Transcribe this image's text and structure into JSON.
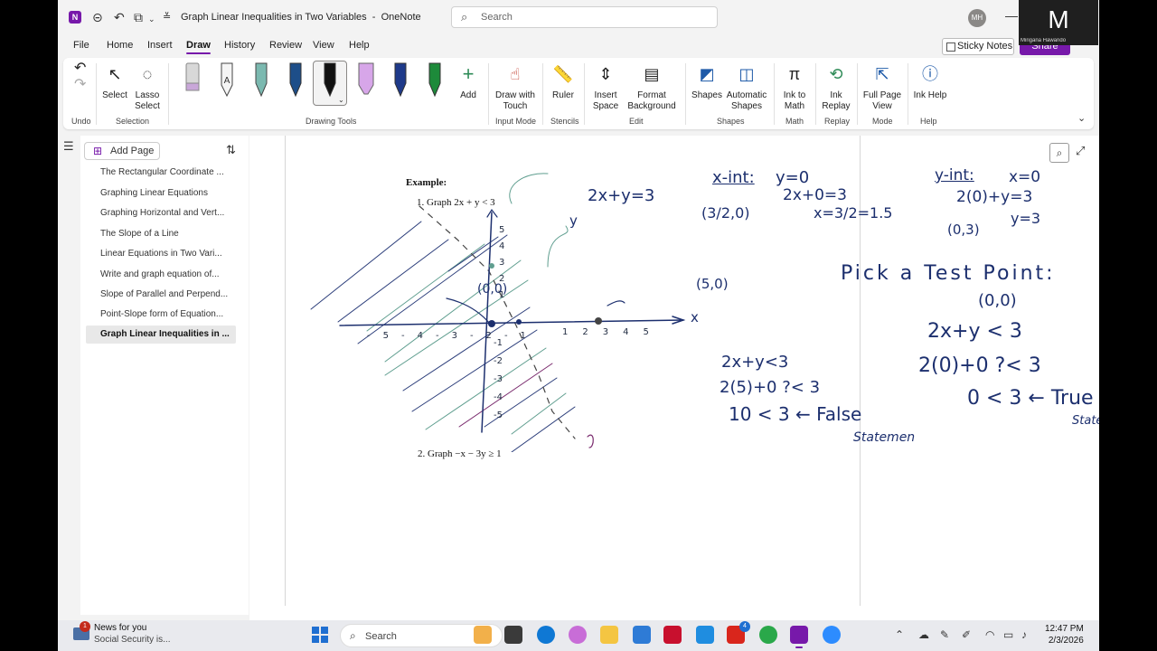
{
  "window": {
    "title": "Graph Linear Inequalities in Two Variables",
    "separator": "-",
    "app_name": "OneNote",
    "search_placeholder": "Search",
    "user_initials": "MH"
  },
  "tabs": [
    "File",
    "Home",
    "Insert",
    "Draw",
    "History",
    "Review",
    "View",
    "Help"
  ],
  "active_tab": "Draw",
  "header_buttons": {
    "sticky_notes": "Sticky Notes",
    "share": "Share"
  },
  "ribbon": {
    "select": "Select",
    "lasso_select": "Lasso Select",
    "add": "Add",
    "draw_with_touch": "Draw with Touch",
    "ruler": "Ruler",
    "insert_space": "Insert Space",
    "format_background": "Format Background",
    "shapes": "Shapes",
    "automatic_shapes": "Automatic Shapes",
    "ink_to_math": "Ink to Math",
    "ink_replay": "Ink Replay",
    "full_page_view": "Full Page View",
    "ink_help": "Ink Help",
    "groups": {
      "undo": "Undo",
      "selection": "Selection",
      "drawing_tools": "Drawing Tools",
      "input_mode": "Input Mode",
      "stencils": "Stencils",
      "edit": "Edit",
      "shapes": "Shapes",
      "math": "Math",
      "replay": "Replay",
      "mode": "Mode",
      "help": "Help"
    },
    "pens": [
      {
        "name": "eraser",
        "color": "#d8d8d8",
        "tip": "#c9a7d9"
      },
      {
        "name": "pencil",
        "color": "#f5f5f5",
        "tip": "#333333"
      },
      {
        "name": "pen-teal",
        "color": "#7bb9b0",
        "tip": "#1f6f6b"
      },
      {
        "name": "pen-navy",
        "color": "#1d4e89",
        "tip": "#1d4e89"
      },
      {
        "name": "pen-black",
        "color": "#111111",
        "tip": "#111111"
      },
      {
        "name": "highlighter-lavender",
        "color": "#d7a6e9",
        "tip": "#c084d6"
      },
      {
        "name": "pen-blue",
        "color": "#1e3a8a",
        "tip": "#1e3a8a"
      },
      {
        "name": "pen-green",
        "color": "#1d8a3a",
        "tip": "#1d8a3a"
      }
    ]
  },
  "pages": {
    "add_page": "Add Page",
    "items": [
      "The Rectangular Coordinate ...",
      "Graphing Linear Equations",
      "Graphing Horizontal and Vert...",
      "The Slope of a Line",
      "Linear Equations in Two Vari...",
      "Write and graph equation of...",
      "Slope of Parallel and Perpend...",
      "Point-Slope form of Equation...",
      "Graph Linear Inequalities in ..."
    ],
    "active_index": 8
  },
  "note": {
    "example_title": "Example:",
    "q1": "1.  Graph 2x + y < 3",
    "q2": "2.  Graph −x − 3y ≥ 1",
    "ink": {
      "eq": "2x+y=3",
      "xint_title": "x-int:",
      "xint_y0": "y=0",
      "xint_step": "2x+0=3",
      "xint_solve": "x=3/2=1.5",
      "xint_point": "(3/2,0)",
      "yint_title": "y-int:",
      "yint_x0": "x=0",
      "yint_step": "2(0)+y=3",
      "yint_solve": "y=3",
      "yint_point": "(0,3)",
      "pick": "Pick a Test Point:",
      "pick_point": "(0,0)",
      "t1": "2x+y < 3",
      "t2": "2(0)+0 ?< 3",
      "t3": "0 < 3 ← True",
      "t3b": "Statement",
      "f1": "2x+y<3",
      "f2": "2(5)+0 ?< 3",
      "f3": "10 < 3 ← False",
      "f3b": "Statemen",
      "origin_label": "(0,0)",
      "test_label": "(5,0)",
      "axis_x": "x",
      "axis_y": "y",
      "x_ticks": [
        "-5",
        "-4",
        "-3",
        "-2",
        "-1",
        "1",
        "2",
        "3",
        "4",
        "5"
      ],
      "y_ticks": [
        "5",
        "4",
        "3",
        "2",
        "1",
        "-1",
        "-2",
        "-3",
        "-4",
        "-5"
      ]
    }
  },
  "video": {
    "initial": "M",
    "name": "Mirigana Hawando"
  },
  "taskbar": {
    "news_badge": "1",
    "news_title": "News for you",
    "news_sub": "Social Security is...",
    "search": "Search",
    "mail_badge": "4",
    "time": "12:47 PM",
    "date": "2/3/2026"
  }
}
